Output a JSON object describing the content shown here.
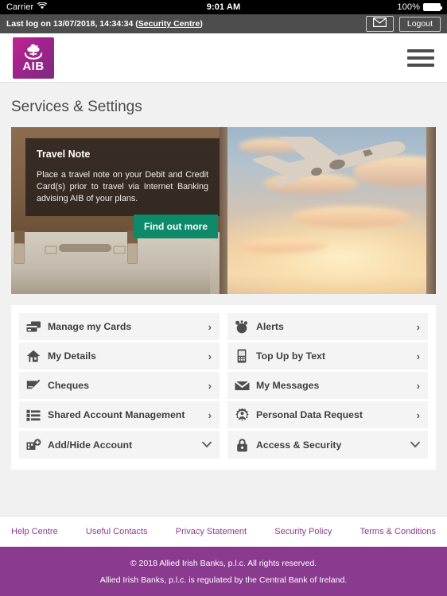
{
  "statusbar": {
    "carrier": "Carrier",
    "wifi_icon": "wifi-icon",
    "time": "9:01 AM",
    "battery_percent": "100%",
    "battery_icon": "battery-icon"
  },
  "utilbar": {
    "last_log_prefix": "Last log on 13/07/2018, 14:34:34 (",
    "security_centre_link": "Security Centre",
    "last_log_suffix": ")",
    "mail_icon": "envelope-icon",
    "logout_label": "Logout"
  },
  "header": {
    "logo_text": "AIB",
    "logo_mark_icon": "aib-bird-logo-icon",
    "menu_icon": "hamburger-menu-icon",
    "logo_gradient_from": "#c2268e",
    "logo_gradient_to": "#7d2b7f"
  },
  "page_title": "Services & Settings",
  "hero": {
    "note_title": "Travel Note",
    "note_body": "Place a travel note on your Debit and Credit Card(s) prior to travel via Internet Banking advising AIB of your plans.",
    "cta_label": "Find out more",
    "cta_color": "#0d8a6a",
    "image_alt": "airplane-taking-off-suitcase-image"
  },
  "menu": {
    "left_column": [
      {
        "label": "Manage my Cards",
        "icon": "credit-cards-icon",
        "chevron": "›"
      },
      {
        "label": "My Details",
        "icon": "house-icon",
        "chevron": "›"
      },
      {
        "label": "Cheques",
        "icon": "cheque-pen-icon",
        "chevron": "›"
      },
      {
        "label": "Shared Account Management",
        "icon": "list-icon",
        "chevron": "›"
      },
      {
        "label": "Add/Hide Account",
        "icon": "add-account-icon",
        "chevron": "⌄"
      }
    ],
    "right_column": [
      {
        "label": "Alerts",
        "icon": "alarm-bell-icon",
        "chevron": "›"
      },
      {
        "label": "Top Up by Text",
        "icon": "mobile-phone-icon",
        "chevron": "›"
      },
      {
        "label": "My Messages",
        "icon": "envelope-icon",
        "chevron": "›"
      },
      {
        "label": "Personal Data Request",
        "icon": "gear-person-icon",
        "chevron": "›"
      },
      {
        "label": "Access & Security",
        "icon": "padlock-icon",
        "chevron": "⌄"
      }
    ]
  },
  "footer_links": [
    {
      "label": "Help Centre"
    },
    {
      "label": "Useful Contacts"
    },
    {
      "label": "Privacy Statement"
    },
    {
      "label": "Security Policy"
    },
    {
      "label": "Terms & Conditions"
    }
  ],
  "footer": {
    "line1": "© 2018 Allied Irish Banks, p.l.c. All rights reserved.",
    "line2": "Allied Irish Banks, p.l.c. is regulated by the Central Bank of Ireland.",
    "background": "#8a3b8f",
    "link_color": "#8e3a8e"
  }
}
